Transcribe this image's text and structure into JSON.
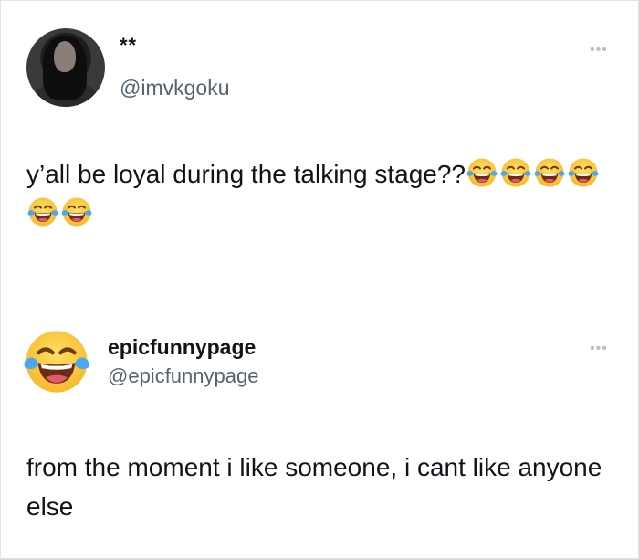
{
  "tweets": [
    {
      "display_name": "**",
      "handle": "@imvkgoku",
      "more_label": "•••",
      "text": "y’all be loyal during the talking stage??",
      "emojis": [
        "face-with-tears-of-joy",
        "face-with-tears-of-joy",
        "face-with-tears-of-joy",
        "face-with-tears-of-joy",
        "face-with-tears-of-joy",
        "face-with-tears-of-joy"
      ]
    },
    {
      "display_name": "epicfunnypage",
      "handle": "@epicfunnypage",
      "more_label": "•••",
      "text": "from the moment i like someone, i cant like anyone else",
      "avatar_icon": "face-with-tears-of-joy"
    }
  ],
  "colors": {
    "text": "#0f1419",
    "secondary_text": "#536471",
    "emoji_face": "#ffcc33",
    "emoji_tears": "#4aa8f0"
  }
}
